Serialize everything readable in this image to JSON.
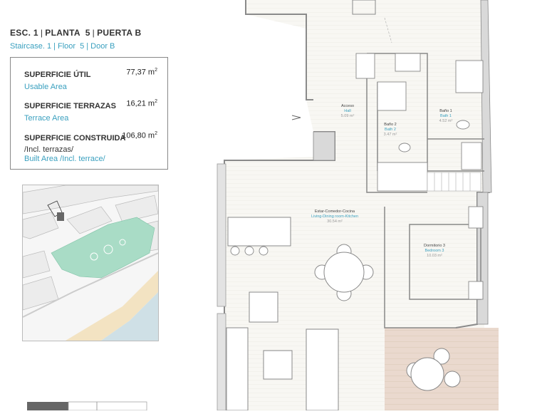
{
  "header": {
    "esc_label": "ESC.",
    "esc_value": "1",
    "planta_label": "PLANTA",
    "planta_value": "5",
    "puerta_label": "PUERTA",
    "puerta_value": "B",
    "staircase_label": "Staircase.",
    "staircase_value": "1",
    "floor_label": "Floor",
    "floor_value": "5",
    "door_label": "Door",
    "door_value": "B"
  },
  "areas": {
    "usable_es": "SUPERFICIE ÚTIL",
    "usable_en": "Usable Area",
    "usable_value": "77,37 m",
    "terrace_es": "SUPERFICIE TERRAZAS",
    "terrace_en": "Terrace Area",
    "terrace_value": "16,21 m",
    "built_es": "SUPERFICIE CONSTRUIDA",
    "built_es2": "/Incl. terrazas/",
    "built_en": "Built Area /Incl. terrace/",
    "built_value": "106,80 m",
    "unit_sup": "2"
  },
  "rooms": {
    "hall_es": "Acceso",
    "hall_en": "Hall",
    "hall_area": "5.09 m²",
    "bath2_es": "Baño 2",
    "bath2_en": "Bath 2",
    "bath2_area": "3.47 m²",
    "bath1_es": "Baño 1",
    "bath1_en": "Bath 1",
    "bath1_area": "4.52 m²",
    "living_es": "Estar-Comedor-Cocina",
    "living_en": "Living-Dining room-Kitchen",
    "living_area": "30.54 m²",
    "bed3_es": "Dormitorio 3",
    "bed3_en": "Bedroom 3",
    "bed3_area": "10.03 m²"
  },
  "colors": {
    "accent": "#3aa0bf",
    "park": "#a9dcc6",
    "beach": "#f3e3c2",
    "sea": "#cfe0e6",
    "terrace": "#ead9ce",
    "highlight": "#666666"
  }
}
